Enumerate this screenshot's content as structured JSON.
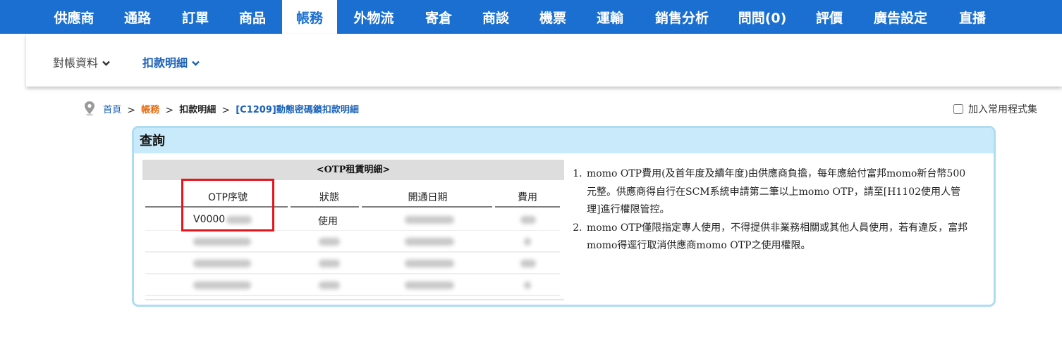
{
  "nav": {
    "items": [
      {
        "label": "供應商"
      },
      {
        "label": "通路"
      },
      {
        "label": "訂單"
      },
      {
        "label": "商品"
      },
      {
        "label": "帳務"
      },
      {
        "label": "外物流"
      },
      {
        "label": "寄倉"
      },
      {
        "label": "商談"
      },
      {
        "label": "機票"
      },
      {
        "label": "運輸"
      },
      {
        "label": "銷售分析"
      },
      {
        "label": "問問(0)"
      },
      {
        "label": "評價"
      },
      {
        "label": "廣告設定"
      },
      {
        "label": "直播"
      }
    ],
    "active_index": 4,
    "color": "#1a6fd0"
  },
  "subnav": {
    "items": [
      {
        "label": "對帳資料",
        "icon": "chevron-down-icon"
      },
      {
        "label": "扣款明細",
        "icon": "chevron-down-icon",
        "active": true
      }
    ]
  },
  "breadcrumb": {
    "icon": "location-pin-icon",
    "home": "首頁",
    "section": "帳務",
    "sub": "扣款明細",
    "page": "[C1209]動態密碼鎖扣款明細",
    "separator": ">"
  },
  "favorite": {
    "label": "加入常用程式集",
    "checked": false
  },
  "query": {
    "title": "查詢",
    "table": {
      "caption": "<OTP租賃明細>",
      "headers": [
        "OTP序號",
        "狀態",
        "開通日期",
        "費用"
      ],
      "rows": [
        {
          "serial": "V0000",
          "status": "使用"
        }
      ],
      "highlight_color": "#e8141b"
    },
    "notes": [
      "momo OTP費用(及首年度及續年度)由供應商負擔，每年應給付富邦momo新台幣500元整。供應商得自行在SCM系統申請第二筆以上momo OTP，請至[H1102使用人管理]進行權限管控。",
      "momo OTP僅限指定專人使用，不得提供非業務相關或其他人員使用，若有違反，富邦momo得逕行取消供應商momo OTP之使用權限。"
    ]
  }
}
